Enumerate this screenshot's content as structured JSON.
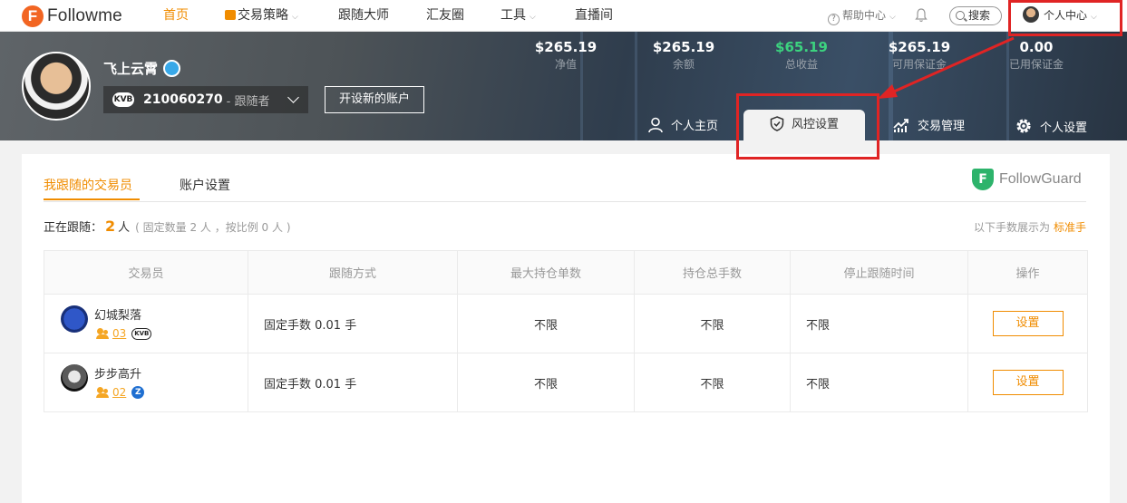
{
  "nav": {
    "logo_text": "Followme",
    "items": [
      {
        "label": "首页",
        "active": true
      },
      {
        "label": "交易策略",
        "has_caret": true
      },
      {
        "label": "跟随大师"
      },
      {
        "label": "汇友圈"
      },
      {
        "label": "工具",
        "has_caret": true
      },
      {
        "label": "直播间"
      }
    ],
    "help_label": "帮助中心",
    "search_label": "搜索",
    "user_center_label": "个人中心"
  },
  "profile": {
    "name": "飞上云霄",
    "account_number": "210060270",
    "account_role": "- 跟随者",
    "open_account_label": "开设新的账户"
  },
  "stats": [
    {
      "value": "$265.19",
      "label": "净值"
    },
    {
      "value": "$265.19",
      "label": "余额"
    },
    {
      "value": "$65.19",
      "label": "总收益",
      "color": "#3cd37f"
    },
    {
      "value": "$265.19",
      "label": "可用保证金"
    },
    {
      "value": "0.00",
      "label": "已用保证金"
    }
  ],
  "banner_tabs": [
    {
      "label": "个人主页",
      "icon": "person-icon"
    },
    {
      "label": "风控设置",
      "icon": "shield-icon",
      "active": true
    },
    {
      "label": "交易管理",
      "icon": "chart-icon"
    },
    {
      "label": "个人设置",
      "icon": "gear-icon"
    }
  ],
  "content": {
    "tabs": [
      {
        "label": "我跟随的交易员",
        "active": true
      },
      {
        "label": "账户设置"
      }
    ],
    "brand": "FollowGuard",
    "following_prefix": "正在跟随：",
    "following_count": "2",
    "following_unit": "人",
    "following_detail": "( 固定数量 2 人 ，按比例 0 人 )",
    "lot_note": "以下手数展示为",
    "lot_note_emphasis": "标准手"
  },
  "table": {
    "headers": [
      "交易员",
      "跟随方式",
      "最大持仓单数",
      "持仓总手数",
      "停止跟随时间",
      "操作"
    ],
    "rows": [
      {
        "trader": "幻城梨落",
        "followers": "03",
        "method": "固定手数 0.01 手",
        "max_positions": "不限",
        "total_lots": "不限",
        "stop_time": "不限",
        "action": "设置"
      },
      {
        "trader": "步步高升",
        "followers": "02",
        "method": "固定手数 0.01 手",
        "max_positions": "不限",
        "total_lots": "不限",
        "stop_time": "不限",
        "action": "设置"
      }
    ]
  },
  "colors": {
    "accent": "#f08c00",
    "annotation_red": "#e02424",
    "profit_green": "#3cd37f"
  }
}
